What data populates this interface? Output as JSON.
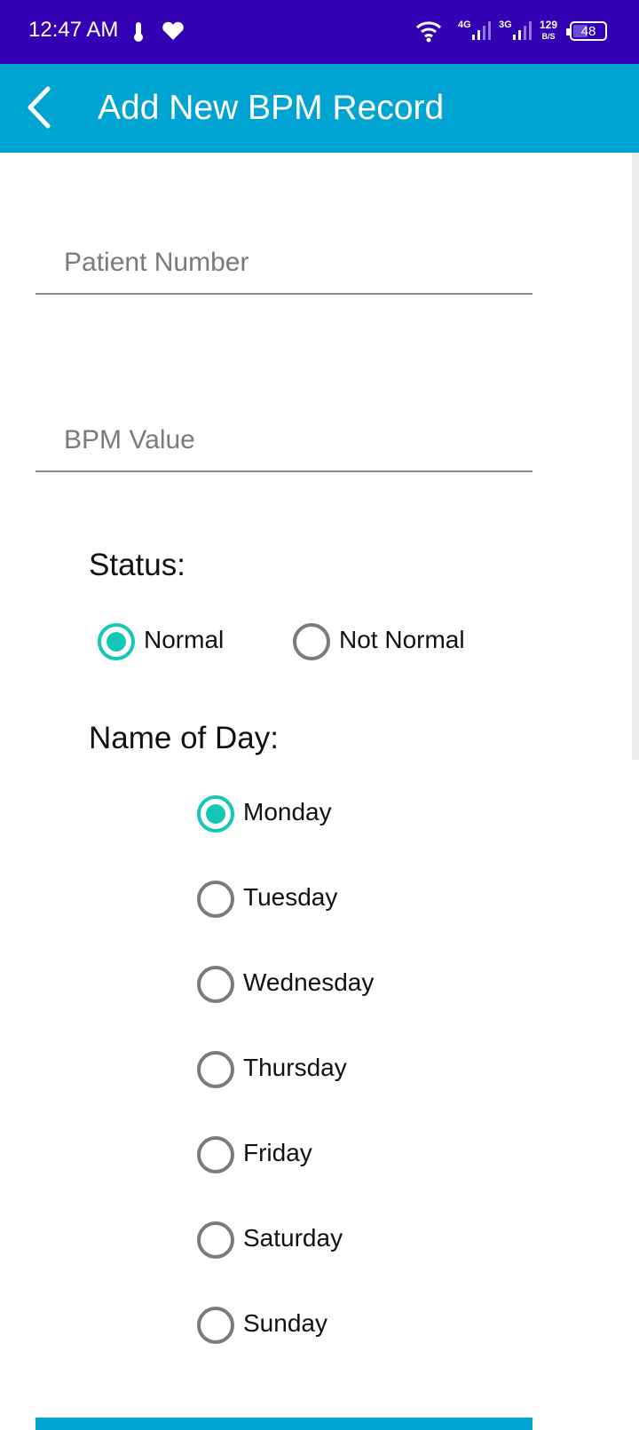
{
  "status_bar": {
    "time": "12:47 AM",
    "icons": [
      "thermometer-icon",
      "heart-icon",
      "wifi-icon",
      "signal-4g-icon",
      "signal-3g-icon"
    ],
    "sig1_label": "4G",
    "sig2_label": "3G",
    "speed_value": "129",
    "speed_unit": "B/S",
    "battery": "48",
    "battery_level": 0.48
  },
  "app_bar": {
    "title": "Add New BPM Record",
    "back_icon": "chevron-left-icon"
  },
  "form": {
    "patient_number_placeholder": "Patient Number",
    "bpm_value_placeholder": "BPM Value",
    "status_label": "Status:",
    "status_options": [
      "Normal",
      "Not Normal"
    ],
    "status_selected": "Normal",
    "day_label": "Name of Day:",
    "day_options": [
      "Monday",
      "Tuesday",
      "Wednesday",
      "Thursday",
      "Friday",
      "Saturday",
      "Sunday"
    ],
    "day_selected": "Monday"
  },
  "colors": {
    "status_bar": "#3300b3",
    "app_bar": "#00a4d3",
    "radio_checked": "#16c7b8",
    "radio_unchecked": "#7b7b7b"
  }
}
